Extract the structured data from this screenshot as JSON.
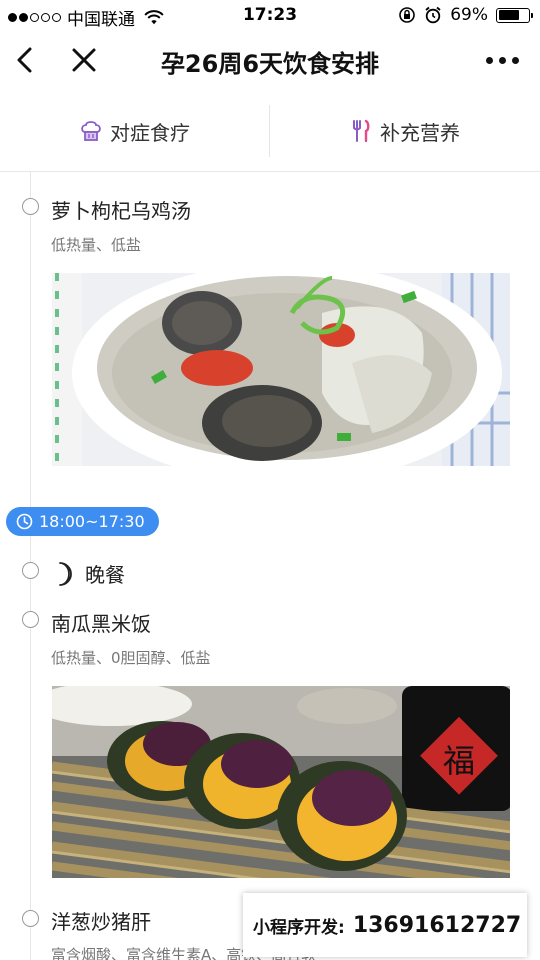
{
  "status_bar": {
    "carrier": "中国联通",
    "time": "17:23",
    "battery_percent": "69%",
    "battery_level": 0.69
  },
  "nav": {
    "title": "孕26周6天饮食安排",
    "back_icon": "chevron-left-icon",
    "close_icon": "close-icon",
    "more_icon": "more-icon"
  },
  "tabs": [
    {
      "label": "对症食疗",
      "icon": "chef-hat-icon",
      "color": "#8a5cc7"
    },
    {
      "label": "补充营养",
      "icon": "fork-knife-icon",
      "color": "#8a5cc7"
    }
  ],
  "timeline": {
    "items": [
      {
        "title": "萝卜枸杞乌鸡汤",
        "tags": "低热量、低盐"
      },
      {
        "title": "南瓜黑米饭",
        "tags": "低热量、0胆固醇、低盐"
      },
      {
        "title": "洋葱炒猪肝",
        "tags": "富含烟酸、富含维生素A、高铁、高且软"
      }
    ],
    "time_slot": "18:00~17:30",
    "meal": "晚餐"
  },
  "promo": {
    "label": "小程序开发:",
    "phone": "13691612727"
  },
  "colors": {
    "accent": "#3d8ef0",
    "tab_icon": "#8a5cc7"
  }
}
